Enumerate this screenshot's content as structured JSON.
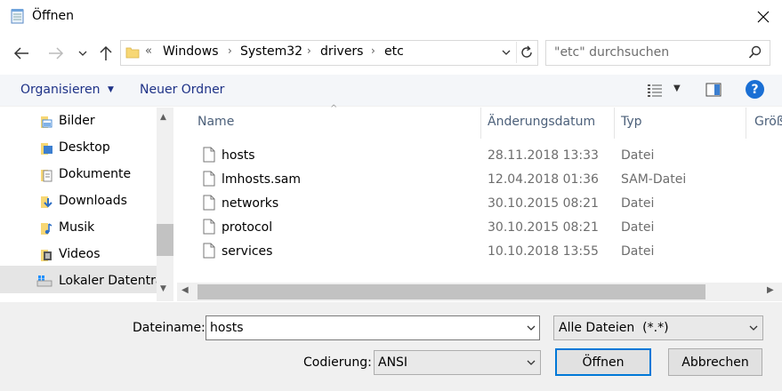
{
  "window": {
    "title": "Öffnen"
  },
  "address": {
    "crumbs": [
      "Windows",
      "System32",
      "drivers",
      "etc"
    ],
    "prefix": "«"
  },
  "search": {
    "placeholder": "\"etc\" durchsuchen"
  },
  "toolbar": {
    "organize": "Organisieren",
    "new_folder": "Neuer Ordner"
  },
  "tree": {
    "items": [
      {
        "label": "Bilder",
        "icon": "pictures-folder-icon"
      },
      {
        "label": "Desktop",
        "icon": "desktop-folder-icon"
      },
      {
        "label": "Dokumente",
        "icon": "documents-folder-icon"
      },
      {
        "label": "Downloads",
        "icon": "downloads-folder-icon"
      },
      {
        "label": "Musik",
        "icon": "music-folder-icon"
      },
      {
        "label": "Videos",
        "icon": "videos-folder-icon"
      },
      {
        "label": "Lokaler Datenträ",
        "icon": "local-drive-icon",
        "selected": true
      }
    ]
  },
  "columns": {
    "name": "Name",
    "date": "Änderungsdatum",
    "type": "Typ",
    "size": "Größ"
  },
  "files": [
    {
      "name": "hosts",
      "date": "28.11.2018 13:33",
      "type": "Datei"
    },
    {
      "name": "lmhosts.sam",
      "date": "12.04.2018 01:36",
      "type": "SAM-Datei"
    },
    {
      "name": "networks",
      "date": "30.10.2015 08:21",
      "type": "Datei"
    },
    {
      "name": "protocol",
      "date": "30.10.2015 08:21",
      "type": "Datei"
    },
    {
      "name": "services",
      "date": "10.10.2018 13:55",
      "type": "Datei"
    }
  ],
  "bottom": {
    "filename_label": "Dateiname:",
    "filename_value": "hosts",
    "filter_value": "Alle Dateien  (*.*)",
    "encoding_label": "Codierung:",
    "encoding_value": "ANSI",
    "open_label": "Öffnen",
    "cancel_label": "Abbrechen"
  },
  "colors": {
    "accent": "#0078d7",
    "link": "#1e3287",
    "selection": "#e5e5e5",
    "help": "#1a6fd4"
  }
}
